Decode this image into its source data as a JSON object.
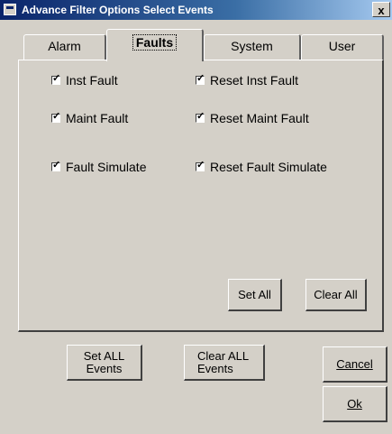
{
  "window": {
    "title": "Advance Filter Options  Select Events",
    "close_glyph": "x"
  },
  "tabs": [
    {
      "label": "Alarm",
      "active": false
    },
    {
      "label": "Faults",
      "active": true
    },
    {
      "label": "System",
      "active": false
    },
    {
      "label": "User",
      "active": false
    }
  ],
  "faults": {
    "checkboxes": [
      {
        "label": "Inst Fault",
        "checked": true
      },
      {
        "label": "Reset Inst Fault",
        "checked": true
      },
      {
        "label": "Maint Fault",
        "checked": true
      },
      {
        "label": "Reset Maint Fault",
        "checked": true
      },
      {
        "label": "Fault Simulate",
        "checked": true
      },
      {
        "label": "Reset Fault Simulate",
        "checked": true
      }
    ],
    "set_all_label": "Set All",
    "clear_all_label": "Clear All"
  },
  "footer": {
    "set_all_events": [
      "Set ALL",
      "Events"
    ],
    "clear_all_events": [
      "Clear ALL",
      "Events"
    ],
    "cancel_label": "Cancel",
    "ok_label": "Ok"
  }
}
